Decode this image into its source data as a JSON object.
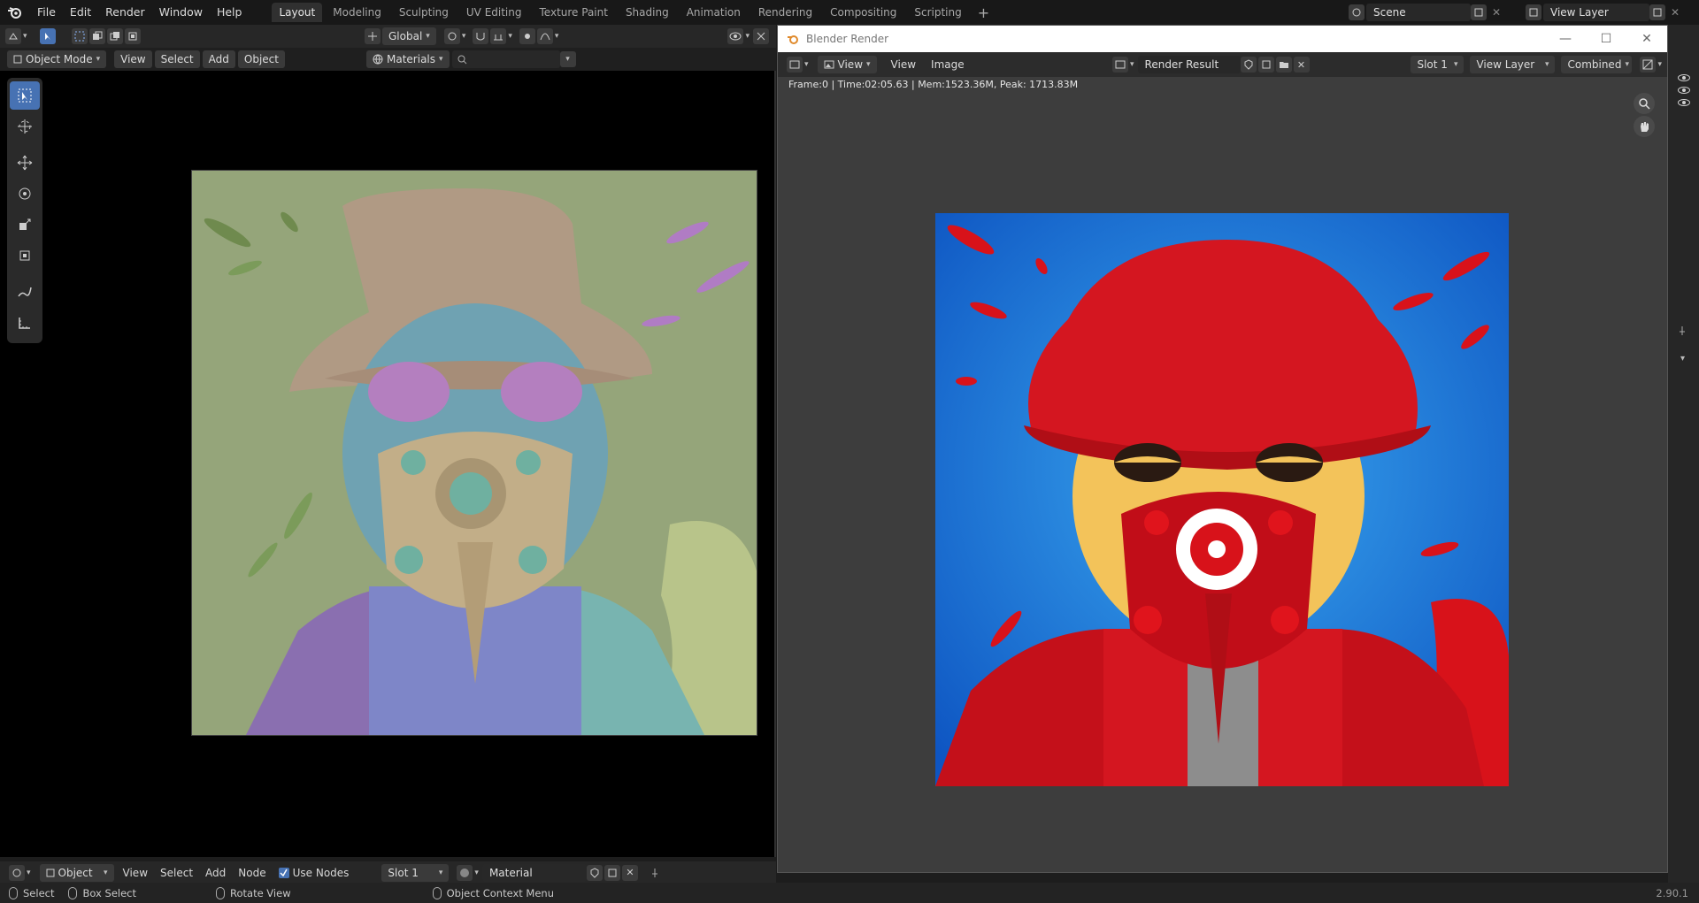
{
  "menubar": {
    "items": [
      "File",
      "Edit",
      "Render",
      "Window",
      "Help"
    ]
  },
  "workspaces": {
    "tabs": [
      "Layout",
      "Modeling",
      "Sculpting",
      "UV Editing",
      "Texture Paint",
      "Shading",
      "Animation",
      "Rendering",
      "Compositing",
      "Scripting"
    ],
    "active": "Layout",
    "add_label": "+"
  },
  "scene": {
    "label": "Scene"
  },
  "view_layer": {
    "label": "View Layer"
  },
  "viewport_header": {
    "mode": "Object Mode",
    "menus": [
      "View",
      "Select",
      "Add",
      "Object"
    ],
    "transform_orientation": "Global",
    "shading_dropdown": "Materials"
  },
  "viewport_footer": {
    "editor_type": "Object",
    "menus": [
      "View",
      "Select",
      "Add",
      "Node"
    ],
    "use_nodes_label": "Use Nodes",
    "slot": "Slot 1",
    "material": "Material"
  },
  "render_window": {
    "title": "Blender Render",
    "menus": [
      "View",
      "View",
      "Image"
    ],
    "image_name": "Render Result",
    "slot": "Slot 1",
    "view_layer": "View Layer",
    "pass": "Combined",
    "info": "Frame:0 | Time:02:05.63 | Mem:1523.36M, Peak: 1713.83M"
  },
  "statusbar": {
    "select": "Select",
    "box_select": "Box Select",
    "rotate_view": "Rotate View",
    "context_menu": "Object Context Menu",
    "version": "2.90.1"
  },
  "colors": {
    "accent": "#4772b3",
    "viewport_bg": "#000000",
    "render_bg": "#3d3d3d",
    "clay_bg": "#95a57a",
    "render_sky": "#1a73d6",
    "render_red": "#d8121a"
  }
}
